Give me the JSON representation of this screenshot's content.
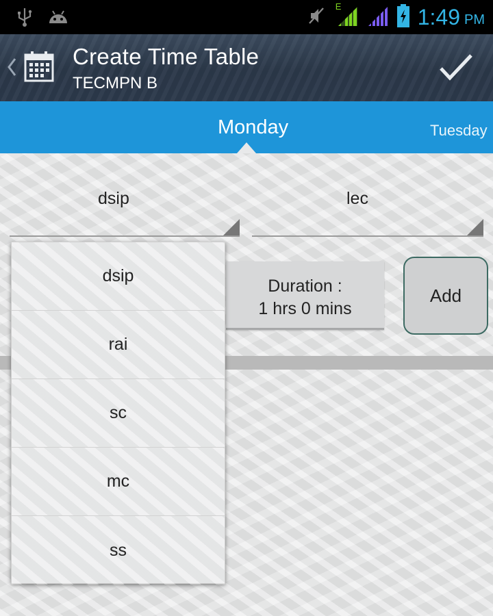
{
  "status_bar": {
    "time": "1:49",
    "ampm": "PM",
    "network_label": "E",
    "icons": [
      "usb-icon",
      "android-icon",
      "mute-icon",
      "signal-icon",
      "signal-icon-2",
      "battery-charging-icon"
    ]
  },
  "action_bar": {
    "title": "Create Time Table",
    "subtitle": "TECMPN B",
    "back_icon": "chevron-left-icon",
    "app_icon": "calendar-icon",
    "confirm_icon": "check-icon"
  },
  "tabs": {
    "current": "Monday",
    "next": "Tuesday"
  },
  "form": {
    "subject_value": "dsip",
    "type_value": "lec",
    "duration_label": "Duration :",
    "duration_value": "1 hrs 0 mins",
    "add_label": "Add"
  },
  "dropdown": {
    "options": [
      "dsip",
      "rai",
      "sc",
      "mc",
      "ss"
    ]
  },
  "colors": {
    "accent": "#33b5e5",
    "tab_strip": "#1e95d9",
    "action_bar": "#2b3849"
  }
}
